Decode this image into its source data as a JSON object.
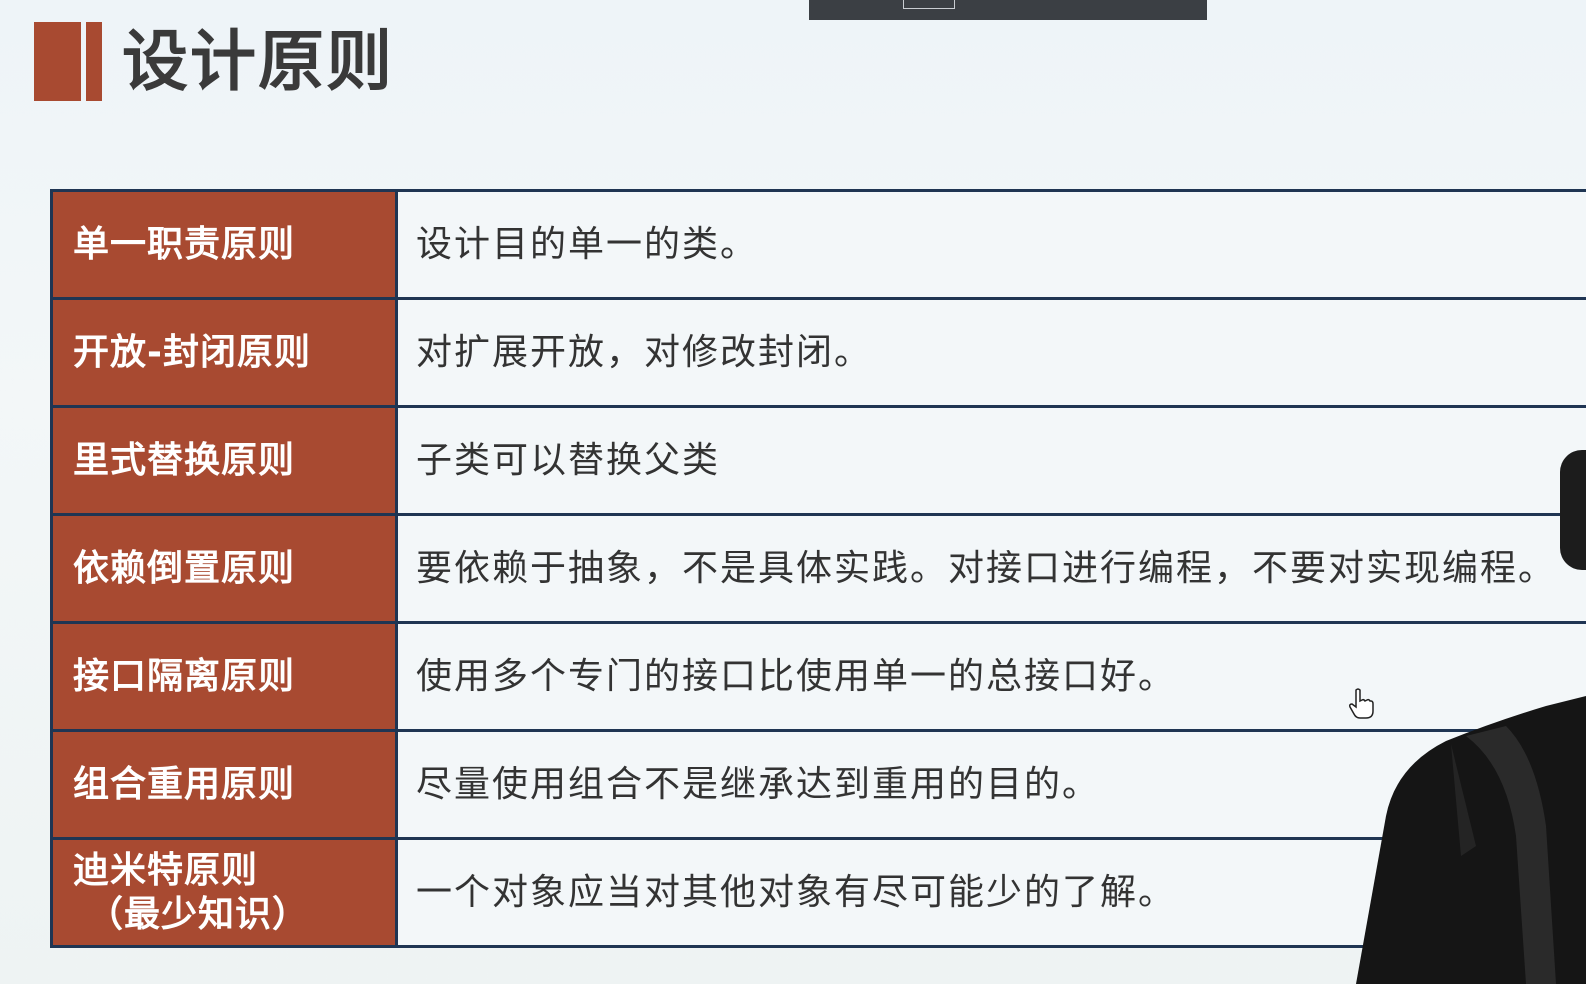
{
  "title": "设计原则",
  "rows": [
    {
      "name": "单一职责原则",
      "description": "设计目的单一的类。"
    },
    {
      "name": "开放-封闭原则",
      "description": "对扩展开放，对修改封闭。"
    },
    {
      "name": "里式替换原则",
      "description": "子类可以替换父类"
    },
    {
      "name": "依赖倒置原则",
      "description": "要依赖于抽象，不是具体实践。对接口进行编程，不要对实现编程。"
    },
    {
      "name": "接口隔离原则",
      "description": "使用多个专门的接口比使用单一的总接口好。"
    },
    {
      "name": "组合重用原则",
      "description": "尽量使用组合不是继承达到重用的目的。"
    },
    {
      "name": "迪米特原则",
      "name_sub": "（最少知识）",
      "description": "一个对象应当对其他对象有尽可能少的了解。"
    }
  ],
  "colors": {
    "accent": "#a84a31",
    "border": "#1f3553",
    "background": "#f3f7f9"
  }
}
